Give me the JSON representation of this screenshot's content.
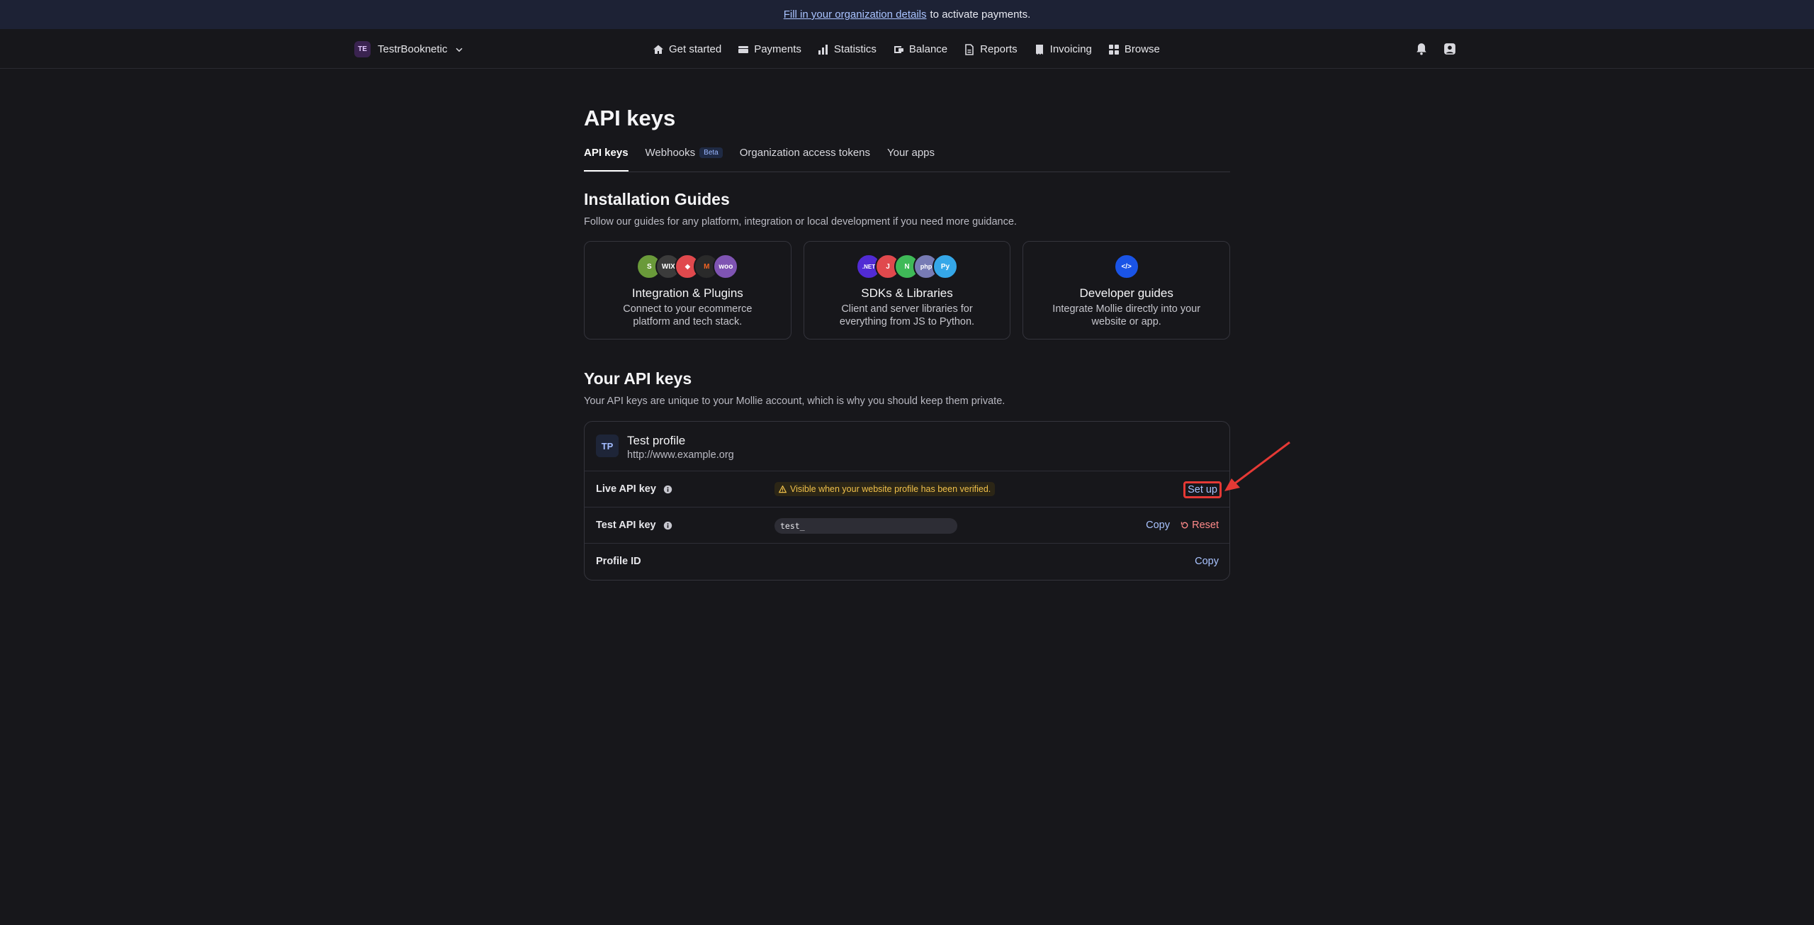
{
  "banner": {
    "link_text": "Fill in your organization details",
    "rest_text": "to activate payments."
  },
  "org": {
    "initials": "TE",
    "name": "TestrBooknetic"
  },
  "nav": [
    {
      "label": "Get started",
      "icon": "home-icon"
    },
    {
      "label": "Payments",
      "icon": "payments-icon"
    },
    {
      "label": "Statistics",
      "icon": "statistics-icon"
    },
    {
      "label": "Balance",
      "icon": "balance-icon"
    },
    {
      "label": "Reports",
      "icon": "reports-icon"
    },
    {
      "label": "Invoicing",
      "icon": "invoicing-icon"
    },
    {
      "label": "Browse",
      "icon": "browse-icon"
    }
  ],
  "page_title": "API keys",
  "tabs": [
    {
      "label": "API keys"
    },
    {
      "label": "Webhooks",
      "badge": "Beta"
    },
    {
      "label": "Organization access tokens"
    },
    {
      "label": "Your apps"
    }
  ],
  "guides_section": {
    "title": "Installation Guides",
    "subtitle": "Follow our guides for any platform, integration or local development if you need more guidance.",
    "cards": [
      {
        "title": "Integration & Plugins",
        "desc": "Connect to your ecommerce platform and tech stack."
      },
      {
        "title": "SDKs & Libraries",
        "desc": "Client and server libraries for everything from JS to Python."
      },
      {
        "title": "Developer guides",
        "desc": "Integrate Mollie directly into your website or app."
      }
    ]
  },
  "keys_section": {
    "title": "Your API keys",
    "subtitle": "Your API keys are unique to your Mollie account, which is why you should keep them private.",
    "profile": {
      "initials": "TP",
      "name": "Test profile",
      "url": "http://www.example.org"
    },
    "live": {
      "label": "Live API key",
      "warning": "Visible when your website profile has been verified.",
      "action": "Set up"
    },
    "test": {
      "label": "Test API key",
      "value": "test_",
      "copy": "Copy",
      "reset": "Reset"
    },
    "profile_id": {
      "label": "Profile ID",
      "copy": "Copy"
    }
  },
  "colors": {
    "accent_link": "#a9c3ff",
    "warning": "#f0c04a",
    "danger": "#ff8a8a",
    "highlight": "#e53935"
  }
}
